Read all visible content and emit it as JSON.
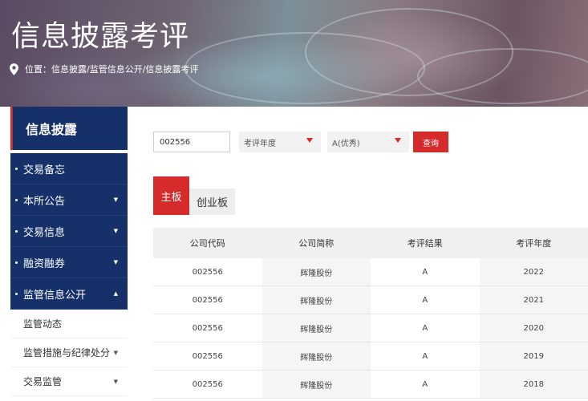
{
  "header": {
    "title": "信息披露考评",
    "location_text": "位置：信息披露/监管信息公开/信息披露考评"
  },
  "sidebar": {
    "title": "信息披露",
    "items": [
      {
        "label": "交易备忘",
        "arrow": ""
      },
      {
        "label": "本所公告",
        "arrow": "▼"
      },
      {
        "label": "交易信息",
        "arrow": "▼"
      },
      {
        "label": "融资融券",
        "arrow": "▼"
      },
      {
        "label": "监管信息公开",
        "arrow": "▲"
      }
    ],
    "sub_items": [
      {
        "label": "监管动态",
        "arrow": ""
      },
      {
        "label": "监管措施与纪律处分",
        "arrow": "▼"
      },
      {
        "label": "交易监管",
        "arrow": "▼"
      }
    ]
  },
  "filters": {
    "code_value": "002556",
    "year_select": "考评年度",
    "result_select": "A(优秀)",
    "query_label": "查询"
  },
  "tabs": [
    {
      "label": "主板"
    },
    {
      "label": "创业板"
    }
  ],
  "table": {
    "headers": [
      "公司代码",
      "公司简称",
      "考评结果",
      "考评年度"
    ],
    "rows": [
      [
        "002556",
        "辉隆股份",
        "A",
        "2022"
      ],
      [
        "002556",
        "辉隆股份",
        "A",
        "2021"
      ],
      [
        "002556",
        "辉隆股份",
        "A",
        "2020"
      ],
      [
        "002556",
        "辉隆股份",
        "A",
        "2019"
      ],
      [
        "002556",
        "辉隆股份",
        "A",
        "2018"
      ]
    ]
  },
  "colors": {
    "accent": "#d52b2b",
    "nav_bg": "#16306a"
  },
  "icons": {
    "location": "map-pin-icon"
  }
}
